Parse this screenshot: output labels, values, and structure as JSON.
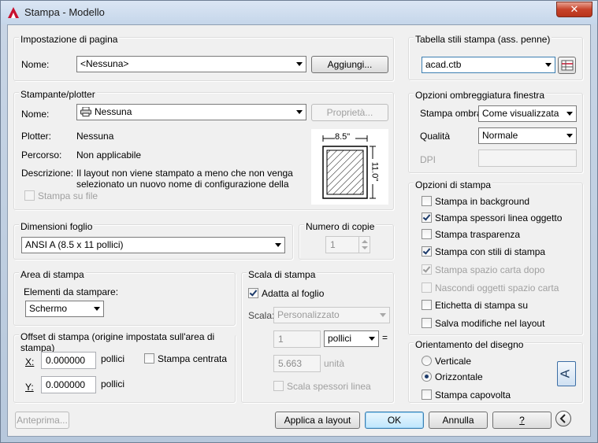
{
  "window": {
    "title": "Stampa - Modello",
    "close_label": "✕"
  },
  "page_setup": {
    "group_title": "Impostazione di pagina",
    "name_label": "Nome:",
    "name_value": "<Nessuna>",
    "add_button": "Aggiungi..."
  },
  "printer": {
    "group_title": "Stampante/plotter",
    "name_label": "Nome:",
    "name_value": "Nessuna",
    "properties_button": "Proprietà...",
    "plotter_label": "Plotter:",
    "plotter_value": "Nessuna",
    "path_label": "Percorso:",
    "path_value": "Non applicabile",
    "description_label": "Descrizione:",
    "description_line1": "Il layout non viene stampato a meno che non venga",
    "description_line2": "selezionato un nuovo nome di configurazione della",
    "print_to_file_label": "Stampa su file",
    "print_to_file_checked": false,
    "preview_width": "8.5\"",
    "preview_height": "11.0\""
  },
  "paper_size": {
    "group_title": "Dimensioni foglio",
    "value": "ANSI A (8.5 x 11 pollici)"
  },
  "copies": {
    "group_title": "Numero di copie",
    "value": "1"
  },
  "plot_area": {
    "group_title": "Area di stampa",
    "what_label": "Elementi da stampare:",
    "what_value": "Schermo"
  },
  "plot_scale": {
    "group_title": "Scala di stampa",
    "fit_label": "Adatta al foglio",
    "fit_checked": true,
    "scale_label": "Scala:",
    "scale_value": "Personalizzato",
    "value1": "1",
    "unit_value": "pollici",
    "equals": "=",
    "value2": "5.663",
    "unit2_label": "unità",
    "lineweights_label": "Scala spessori linea",
    "lineweights_checked": false
  },
  "plot_offset": {
    "group_title": "Offset di stampa (origine impostata sull'area di stampa)",
    "x_label": "X:",
    "x_value": "0.000000",
    "x_unit": "pollici",
    "y_label": "Y:",
    "y_value": "0.000000",
    "y_unit": "pollici",
    "center_label": "Stampa centrata",
    "center_checked": false
  },
  "plot_style_table": {
    "group_title": "Tabella stili stampa (ass. penne)",
    "value": "acad.ctb"
  },
  "shaded_viewport": {
    "group_title": "Opzioni ombreggiatura finestra",
    "shade_label": "Stampa ombra",
    "shade_value": "Come visualizzata",
    "quality_label": "Qualità",
    "quality_value": "Normale",
    "dpi_label": "DPI",
    "dpi_value": ""
  },
  "plot_options": {
    "group_title": "Opzioni di stampa",
    "items": [
      {
        "label": "Stampa in background",
        "checked": false,
        "enabled": true
      },
      {
        "label": "Stampa spessori linea oggetto",
        "checked": true,
        "enabled": true
      },
      {
        "label": "Stampa trasparenza",
        "checked": false,
        "enabled": true
      },
      {
        "label": "Stampa con stili di stampa",
        "checked": true,
        "enabled": true
      },
      {
        "label": "Stampa spazio carta dopo",
        "checked": true,
        "enabled": false
      },
      {
        "label": "Nascondi oggetti spazio carta",
        "checked": false,
        "enabled": false
      },
      {
        "label": "Etichetta di stampa su",
        "checked": false,
        "enabled": true
      },
      {
        "label": "Salva modifiche nel layout",
        "checked": false,
        "enabled": true
      }
    ]
  },
  "orientation": {
    "group_title": "Orientamento del disegno",
    "portrait_label": "Verticale",
    "landscape_label": "Orizzontale",
    "selected": "landscape",
    "upside_down_label": "Stampa capovolta",
    "upside_down_checked": false,
    "preview_letter": "A"
  },
  "footer": {
    "preview_button": "Anteprima...",
    "apply_button": "Applica a layout",
    "ok_button": "OK",
    "cancel_button": "Annulla",
    "help_button": "?"
  }
}
